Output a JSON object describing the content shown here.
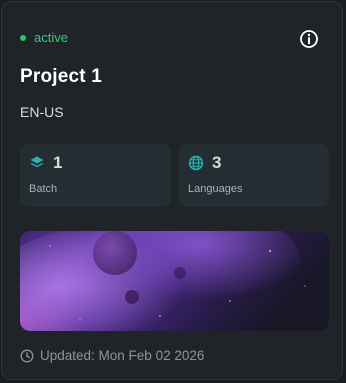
{
  "status": {
    "label": "active",
    "color": "#28c76f"
  },
  "project": {
    "title": "Project 1",
    "locale": "EN-US"
  },
  "stats": [
    {
      "value": "1",
      "label": "Batch",
      "icon": "layers-icon"
    },
    {
      "value": "3",
      "label": "Languages",
      "icon": "globe-icon"
    }
  ],
  "updated": {
    "text": "Updated: Mon Feb 02 2026",
    "icon": "clock-icon"
  },
  "icons": {
    "info": "info-circle-icon"
  },
  "colors": {
    "accent": "#27b3b0",
    "background": "#202428"
  }
}
